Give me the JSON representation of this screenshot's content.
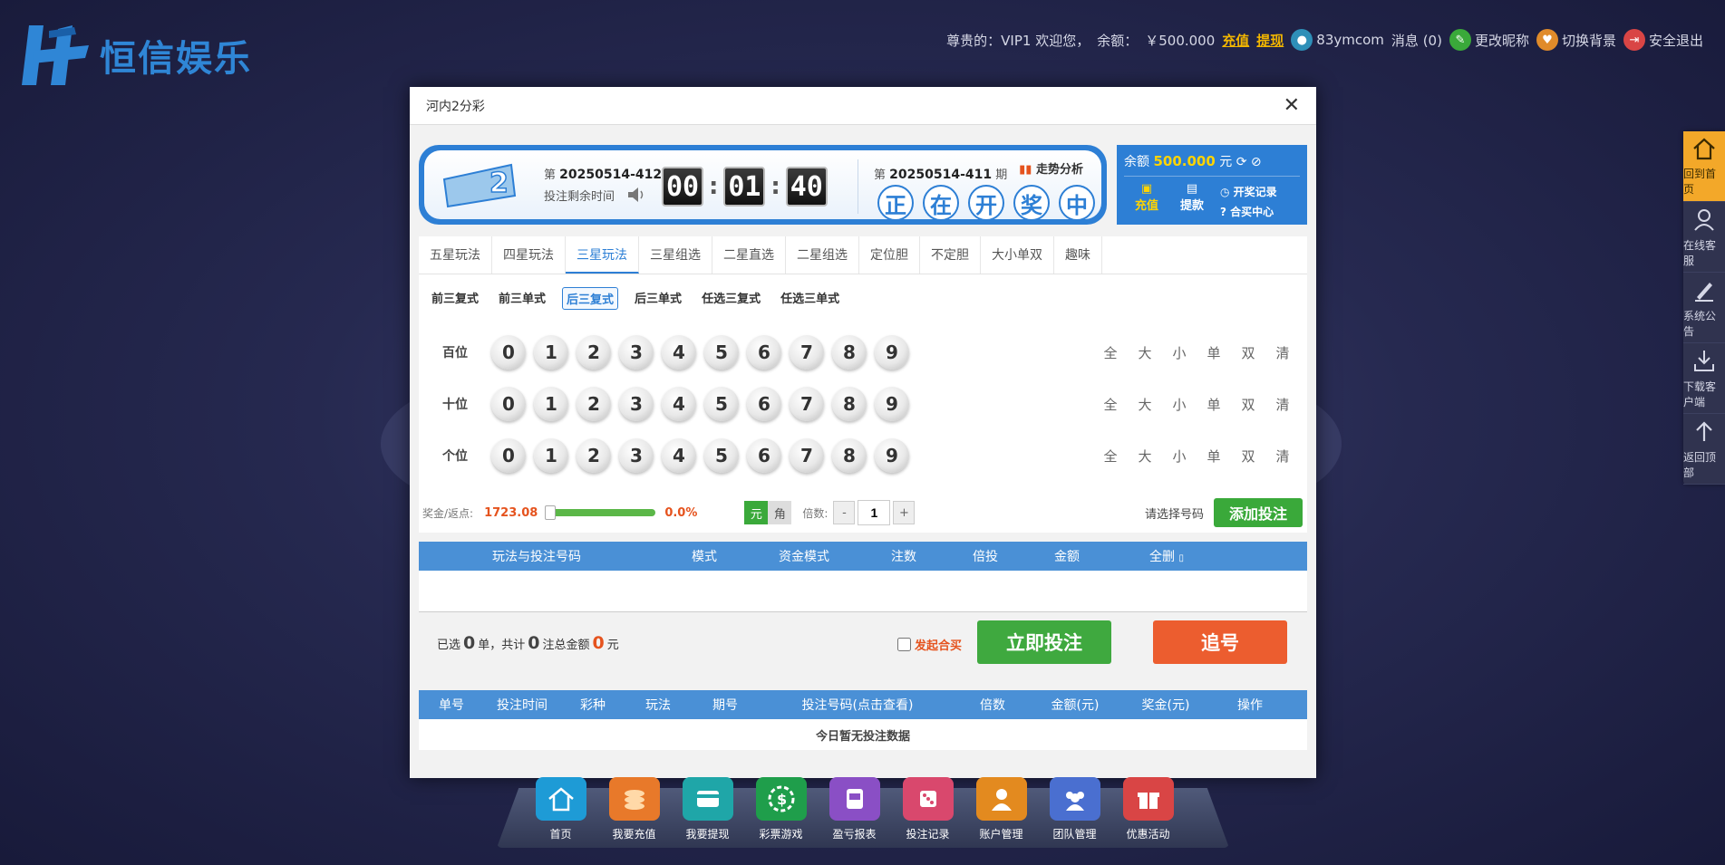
{
  "brand": {
    "name": "恒信娱乐"
  },
  "topbar": {
    "greeting": "尊贵的：VIP1 欢迎您，",
    "balance_label": "余额：",
    "balance_value": "￥500.000",
    "deposit": "充值",
    "withdraw": "提现",
    "username": "83ymcom",
    "messages": "消息 (0)",
    "edit_nickname": "更改昵称",
    "switch_bg": "切换背景",
    "logout": "安全退出"
  },
  "sidenav": [
    {
      "label": "回到首页",
      "icon": "home-icon"
    },
    {
      "label": "在线客服",
      "icon": "support-agent-icon"
    },
    {
      "label": "系统公告",
      "icon": "pen-icon"
    },
    {
      "label": "下载客户端",
      "icon": "download-icon"
    },
    {
      "label": "返回顶部",
      "icon": "arrow-up-icon"
    }
  ],
  "modal": {
    "title": "河内2分彩",
    "current_issue_prefix": "第",
    "current_issue": "20250514-412",
    "issue_suffix": "期",
    "countdown_label": "投注剩余时间",
    "countdown": [
      "00",
      "01",
      "40"
    ],
    "last_issue": "20250514-411",
    "draw_status": [
      "正",
      "在",
      "开",
      "奖",
      "中"
    ],
    "trend": "走势分析",
    "account": {
      "balance_label": "余额",
      "balance": "500.000",
      "unit": "元",
      "deposit": "充值",
      "withdraw": "提款",
      "draw_records": "开奖记录",
      "group_buy": "合买中心"
    },
    "tabs": [
      "五星玩法",
      "四星玩法",
      "三星玩法",
      "三星组选",
      "二星直选",
      "二星组选",
      "定位胆",
      "不定胆",
      "大小单双",
      "趣味"
    ],
    "active_tab": "三星玩法",
    "subtabs": [
      "前三复式",
      "前三单式",
      "后三复式",
      "后三单式",
      "任选三复式",
      "任选三单式"
    ],
    "rows": [
      {
        "label": "百位",
        "numbers": [
          "0",
          "1",
          "2",
          "3",
          "4",
          "5",
          "6",
          "7",
          "8",
          "9"
        ]
      },
      {
        "label": "十位",
        "numbers": [
          "0",
          "1",
          "2",
          "3",
          "4",
          "5",
          "6",
          "7",
          "8",
          "9"
        ]
      },
      {
        "label": "个位",
        "numbers": [
          "0",
          "1",
          "2",
          "3",
          "4",
          "5",
          "6",
          "7",
          "8",
          "9"
        ]
      }
    ],
    "quick_select": [
      "全",
      "大",
      "小",
      "单",
      "双",
      "清"
    ],
    "rebate_label": "奖金/返点:",
    "prize": "1723.08",
    "rebate_pct": "0.0%",
    "mode_yuan": "元",
    "mode_jiao": "角",
    "multiplier_label": "倍数:",
    "multiplier_value": "1",
    "minus": "-",
    "plus": "+",
    "select_hint": "请选择号码",
    "add_bet": "添加投注",
    "cart_headers": [
      "玩法与投注号码",
      "模式",
      "资金模式",
      "注数",
      "倍投",
      "金额",
      "全删"
    ],
    "summary": {
      "selected_prefix": "已选",
      "orders": "0",
      "orders_unit": "单，共计",
      "bets": "0",
      "bets_unit": "注总金额",
      "amount": "0",
      "amount_unit": "元",
      "group_buy": "发起合买",
      "bet_now": "立即投注",
      "chase": "追号"
    },
    "history_headers": [
      "单号",
      "投注时间",
      "彩种",
      "玩法",
      "期号",
      "投注号码(点击查看)",
      "倍数",
      "金额(元)",
      "奖金(元)",
      "操作"
    ],
    "history_empty": "今日暂无投注数据"
  },
  "dock": [
    {
      "label": "首页",
      "color": "#1e9bd6"
    },
    {
      "label": "我要充值",
      "color": "#e8792a"
    },
    {
      "label": "我要提现",
      "color": "#1fa6a8"
    },
    {
      "label": "彩票游戏",
      "color": "#1f9e4b"
    },
    {
      "label": "盈亏报表",
      "color": "#8a4fc5"
    },
    {
      "label": "投注记录",
      "color": "#d9486d"
    },
    {
      "label": "账户管理",
      "color": "#e38a1f"
    },
    {
      "label": "团队管理",
      "color": "#4a6fd0"
    },
    {
      "label": "优惠活动",
      "color": "#d94545"
    }
  ]
}
